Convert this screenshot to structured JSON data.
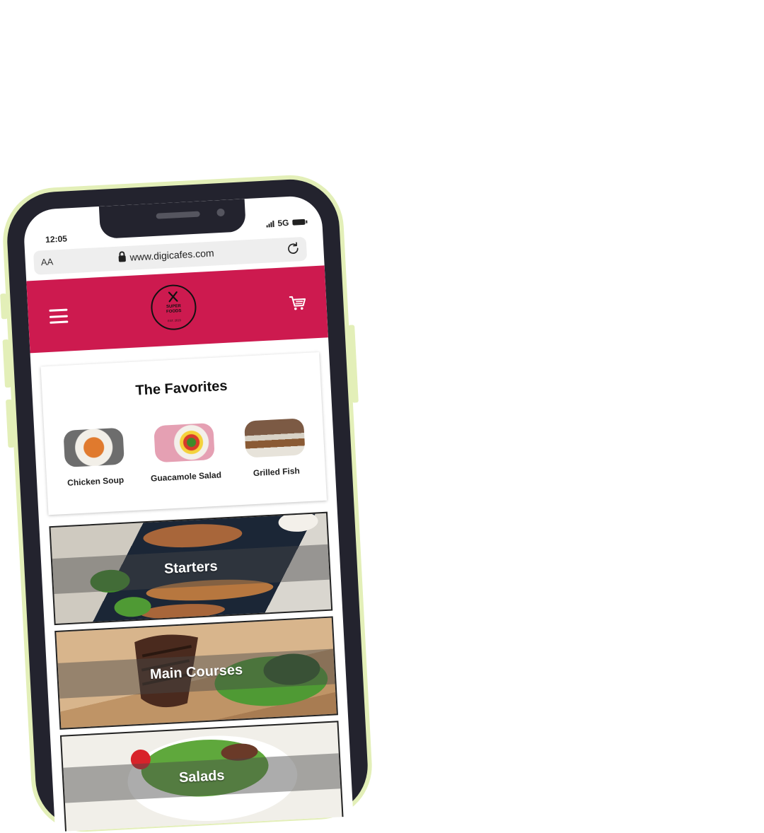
{
  "status": {
    "time": "12:05",
    "network": "5G"
  },
  "browser": {
    "text_size_label": "AA",
    "url": "www.digicafes.com"
  },
  "header": {
    "logo_line1": "SUPER",
    "logo_line2": "FOODS",
    "logo_sub": "EST. 2019"
  },
  "favorites": {
    "title": "The Favorites",
    "items": [
      {
        "label": "Chicken Soup"
      },
      {
        "label": "Guacamole Salad"
      },
      {
        "label": "Grilled Fish"
      }
    ]
  },
  "categories": [
    {
      "label": "Starters"
    },
    {
      "label": "Main Courses"
    },
    {
      "label": "Salads"
    }
  ],
  "colors": {
    "brand": "#cd1a4f",
    "phone_body": "#23232e",
    "phone_outline": "#e3efb8"
  }
}
